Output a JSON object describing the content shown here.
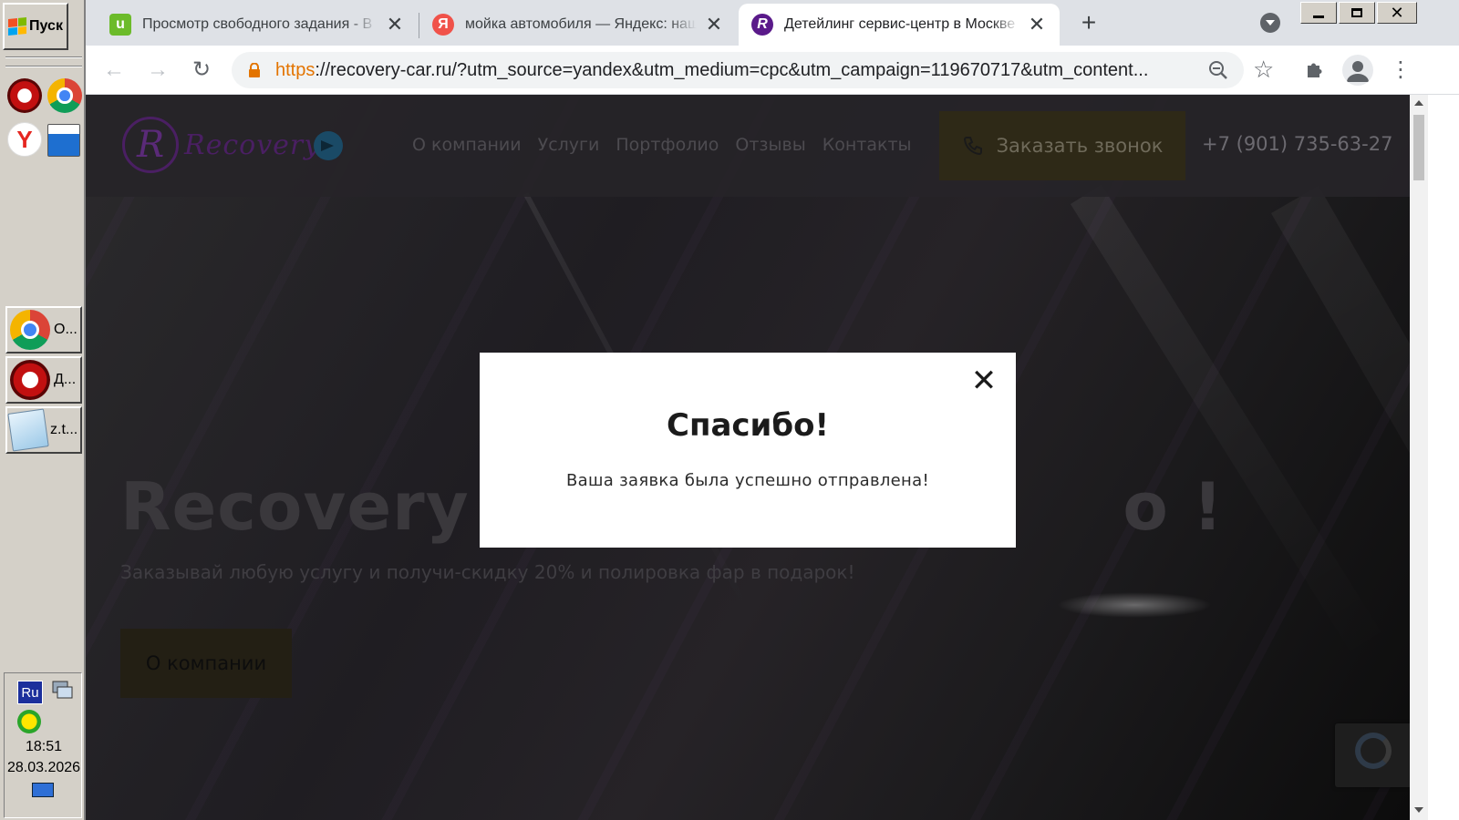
{
  "taskbar": {
    "start_label": "Пуск",
    "tasks": [
      {
        "label": "О...",
        "icon": "chrome-icon"
      },
      {
        "label": "Д...",
        "icon": "opera-icon"
      },
      {
        "label": "z.t...",
        "icon": "notepad-icon"
      }
    ],
    "tray": {
      "lang": "Ru",
      "time": "18:51",
      "date": "28.03.2026"
    }
  },
  "browser": {
    "tabs": [
      {
        "title": "Просмотр свободного задания - В",
        "favicon": "u",
        "favicon_color": "#6cbb2a",
        "active": false
      },
      {
        "title": "мойка автомобиля — Яндекс: наш",
        "favicon": "Я",
        "favicon_color": "#f0524a",
        "active": false
      },
      {
        "title": "Детейлинг сервис-центр в Москве",
        "favicon": "R",
        "favicon_color": "#5a1a8a",
        "active": true
      }
    ],
    "new_tab_label": "+",
    "url_scheme": "https",
    "url_rest": "://recovery-car.ru/?utm_source=yandex&utm_medium=cpc&utm_campaign=119670717&utm_content..."
  },
  "site": {
    "logo_mark": "R",
    "logo_text": "Recovery",
    "nav": [
      "О компании",
      "Услуги",
      "Портфолио",
      "Отзывы",
      "Контакты"
    ],
    "callback_label": "Заказать звонок",
    "phone": "+7 (901) 735-63-27",
    "hero_title": "Recovery Д                        о !",
    "hero_subtitle": "Заказывай любую услугу и получи-скидку 20% и полировка фар в подарок!",
    "about_button": "О компании"
  },
  "modal": {
    "close_glyph": "✕",
    "title": "Спасибо!",
    "message": "Ваша заявка была успешно отправлена!"
  },
  "colors": {
    "url_scheme": "#e37400",
    "brand_purple": "#4a1f63",
    "callback_bg": "#2e2917"
  }
}
